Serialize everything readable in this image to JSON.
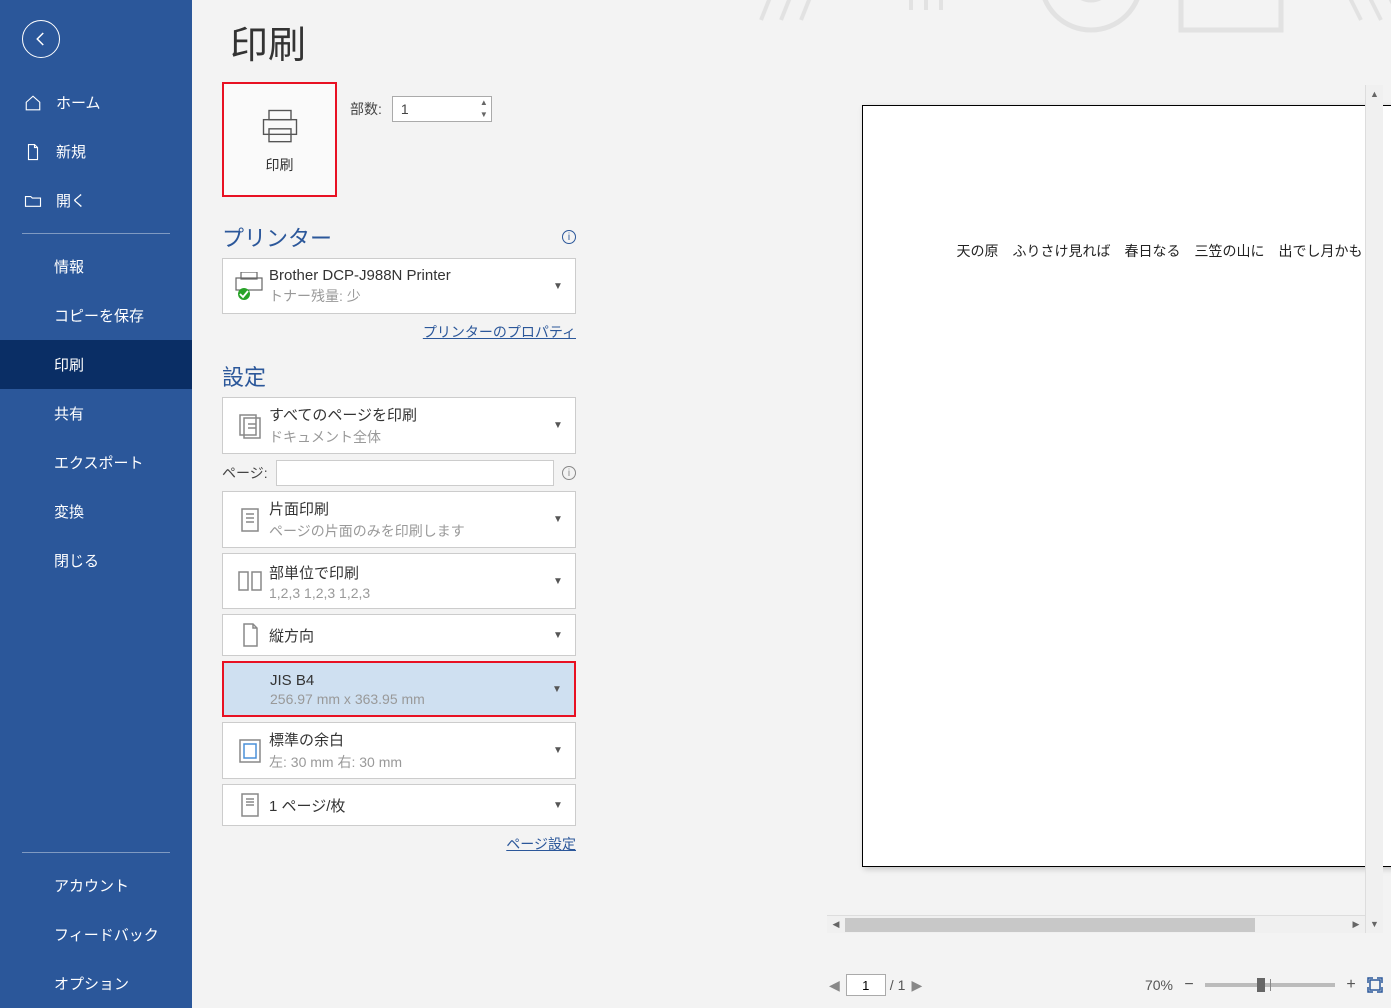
{
  "page_title": "印刷",
  "sidebar": {
    "items": [
      {
        "label": "ホーム",
        "icon": "home"
      },
      {
        "label": "新規",
        "icon": "document"
      },
      {
        "label": "開く",
        "icon": "folder"
      }
    ],
    "sub_items": [
      {
        "label": "情報"
      },
      {
        "label": "コピーを保存"
      },
      {
        "label": "印刷",
        "active": true
      },
      {
        "label": "共有"
      },
      {
        "label": "エクスポート"
      },
      {
        "label": "変換"
      },
      {
        "label": "閉じる"
      }
    ],
    "footer_items": [
      {
        "label": "アカウント"
      },
      {
        "label": "フィードバック"
      },
      {
        "label": "オプション"
      }
    ]
  },
  "print_button_label": "印刷",
  "copies": {
    "label": "部数:",
    "value": "1"
  },
  "printer_section": {
    "header": "プリンター",
    "name": "Brother DCP-J988N Printer",
    "status": "トナー残量: 少",
    "properties_link": "プリンターのプロパティ"
  },
  "settings_section": {
    "header": "設定",
    "print_range": {
      "title": "すべてのページを印刷",
      "sub": "ドキュメント全体"
    },
    "pages": {
      "label": "ページ:",
      "value": ""
    },
    "sides": {
      "title": "片面印刷",
      "sub": "ページの片面のみを印刷します"
    },
    "collation": {
      "title": "部単位で印刷",
      "sub": "1,2,3    1,2,3    1,2,3"
    },
    "orientation": {
      "title": "縦方向"
    },
    "paper_size": {
      "title": "JIS B4",
      "sub": "256.97 mm x 363.95 mm"
    },
    "margins": {
      "title": "標準の余白",
      "sub": "左:  30 mm    右:  30 mm"
    },
    "pages_per_sheet": {
      "title": "1 ページ/枚"
    },
    "page_setup_link": "ページ設定"
  },
  "preview": {
    "doc_text": "天の原　ふりさけ見れば　春日なる　三笠の山に　出でし月かも"
  },
  "status": {
    "current_page": "1",
    "total_pages": "1",
    "page_sep": " / ",
    "zoom_percent": "70%"
  }
}
